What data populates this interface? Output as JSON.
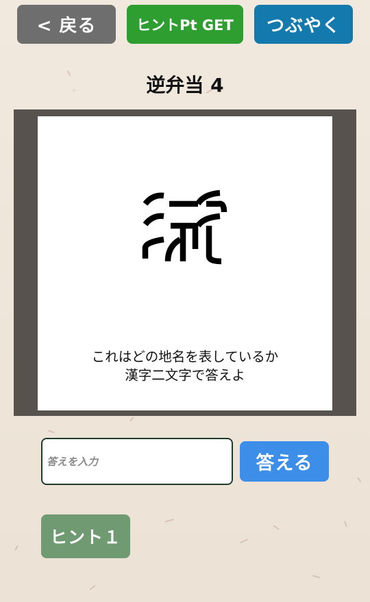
{
  "header": {
    "back_label": "< 戻る",
    "hint_points_label": "ヒントPt GET",
    "tweet_label": "つぶやく"
  },
  "puzzle": {
    "title": "逆弁当 4",
    "glyph_icon": "inverted-kanji-glyph",
    "question_line1": "これはどの地名を表しているか",
    "question_line2": "漢字二文字で答えよ"
  },
  "answer": {
    "value": "",
    "placeholder": "答えを入力",
    "submit_label": "答える"
  },
  "hints": {
    "hint1_label": "ヒント１"
  },
  "colors": {
    "back": "#6e6e6e",
    "hint_points": "#2f9e31",
    "tweet": "#1479ad",
    "answer_button": "#3c8ee8",
    "hint1": "#6f9a72",
    "frame": "#57524d"
  }
}
